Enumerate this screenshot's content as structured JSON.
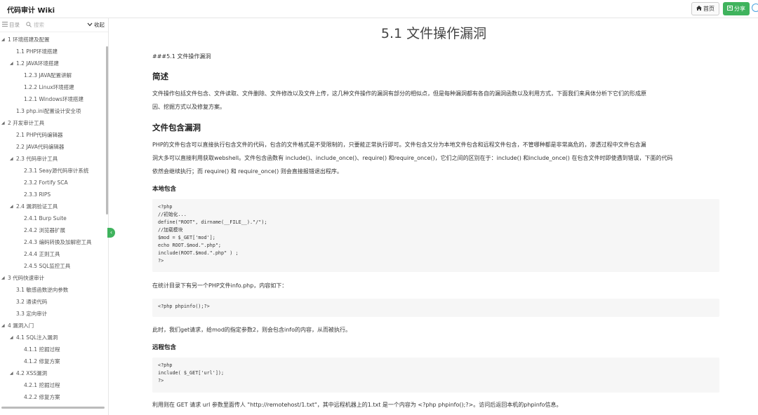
{
  "header": {
    "logo": "代码审计 Wiki",
    "home_label": "首页",
    "share_label": "分享",
    "accent": "#3fb35d"
  },
  "sidebar": {
    "toc_label": "目录",
    "search_placeholder": "搜索",
    "collapse_label": "收起",
    "items": [
      {
        "label": "1 环境搭建及配置",
        "level": 0,
        "expanded": true
      },
      {
        "label": "1.1 PHP环境搭建",
        "level": 1
      },
      {
        "label": "1.2 JAVA环境搭建",
        "level": 1,
        "expanded": true
      },
      {
        "label": "1.2.3 JAVA配置讲解",
        "level": 2
      },
      {
        "label": "1.2.2 Linux环境搭建",
        "level": 2
      },
      {
        "label": "1.2.1 Windows环境搭建",
        "level": 2
      },
      {
        "label": "1.3 php.ini配置设计安全项",
        "level": 1
      },
      {
        "label": "2 开发审计工具",
        "level": 0,
        "expanded": true
      },
      {
        "label": "2.1 PHP代码编辑器",
        "level": 1
      },
      {
        "label": "2.2 JAVA代码编辑器",
        "level": 1
      },
      {
        "label": "2.3 代码审计工具",
        "level": 1,
        "expanded": true
      },
      {
        "label": "2.3.1 Seay源代码审计系统",
        "level": 2
      },
      {
        "label": "2.3.2 Fortify SCA",
        "level": 2
      },
      {
        "label": "2.3.3 RIPS",
        "level": 2
      },
      {
        "label": "2.4 漏洞验证工具",
        "level": 1,
        "expanded": true
      },
      {
        "label": "2.4.1 Burp Suite",
        "level": 2
      },
      {
        "label": "2.4.2 浏览器扩展",
        "level": 2
      },
      {
        "label": "2.4.3 编码转换及加解密工具",
        "level": 2
      },
      {
        "label": "2.4.4 正则工具",
        "level": 2
      },
      {
        "label": "2.4.5 SQL监控工具",
        "level": 2
      },
      {
        "label": "3 代码快速审计",
        "level": 0,
        "expanded": true
      },
      {
        "label": "3.1 敏感函数逆向参数",
        "level": 1
      },
      {
        "label": "3.2 通读代码",
        "level": 1
      },
      {
        "label": "3.3 定向审计",
        "level": 1
      },
      {
        "label": "4 漏洞入门",
        "level": 0,
        "expanded": true
      },
      {
        "label": "4.1 SQL注入漏洞",
        "level": 1,
        "expanded": true
      },
      {
        "label": "4.1.1 挖掘过程",
        "level": 2
      },
      {
        "label": "4.1.2 修复方案",
        "level": 2
      },
      {
        "label": "4.2 XSS漏洞",
        "level": 1,
        "expanded": true
      },
      {
        "label": "4.2.1 挖掘过程",
        "level": 2
      },
      {
        "label": "4.2.2 修复方案",
        "level": 2
      }
    ]
  },
  "main": {
    "title": "5.1 文件操作漏洞",
    "subtitle": "###5.1 文件操作漏洞",
    "h_summary": "简述",
    "summary_p1": "文件操作包括文件包含、文件读取、文件删除、文件修改以及文件上传，这几种文件操作的漏洞有部分的相似点，但是每种漏洞都有各自的漏洞函数以及利用方式，下面我们来具体分析下它们的形成原",
    "summary_p2": "因、挖掘方式以及修复方案。",
    "h_include": "文件包含漏洞",
    "inc_p1": "PHP的文件包含可以直接执行包含文件的代码，包含的文件格式是不受限制的，只要能正常执行即可。文件包含又分为本地文件包含和远程文件包含，不管哪种都是非常高危的，渗透过程中文件包含漏",
    "inc_p2": "洞大多可以直接利用获取webshell。文件包含函数有 include()、include_once()、require() 和require_once()，它们之间的区别在于：include() 和include_once() 在包含文件时即使遇到错误，下面的代码",
    "inc_p3": "依然会继续执行；而 require() 和 require_once() 则会直接报错退出程序。",
    "h_local": "本地包含",
    "code1": "<?php\n//初始化...\ndefine(\"ROOT\", dirname(__FILE__).\"/\");\n//加载模块\n$mod = $_GET['mod'];\necho ROOT.$mod.\".php\";\ninclude(ROOT.$mod.\".php\" ) ;\n?>",
    "stat_p": "在统计目录下有另一个PHP文件info.php，内容如下：",
    "code2": "<?php phpinfo();?>",
    "then_p": "此时，我们get请求，给mod的指定参数2，则会包含info的内容，从而被执行。",
    "h_remote": "远程包含",
    "code3": "<?php\ninclude( $_GET['url']);\n?>",
    "remote_p": "利用则在 GET 请求 url 参数里面传人 \"http://remotehost/1.txt\"，其中远程机器上的1.txt 是一个内容为 <?php phpinfo();?>。访问后返回本机的phpinfo信息。"
  }
}
